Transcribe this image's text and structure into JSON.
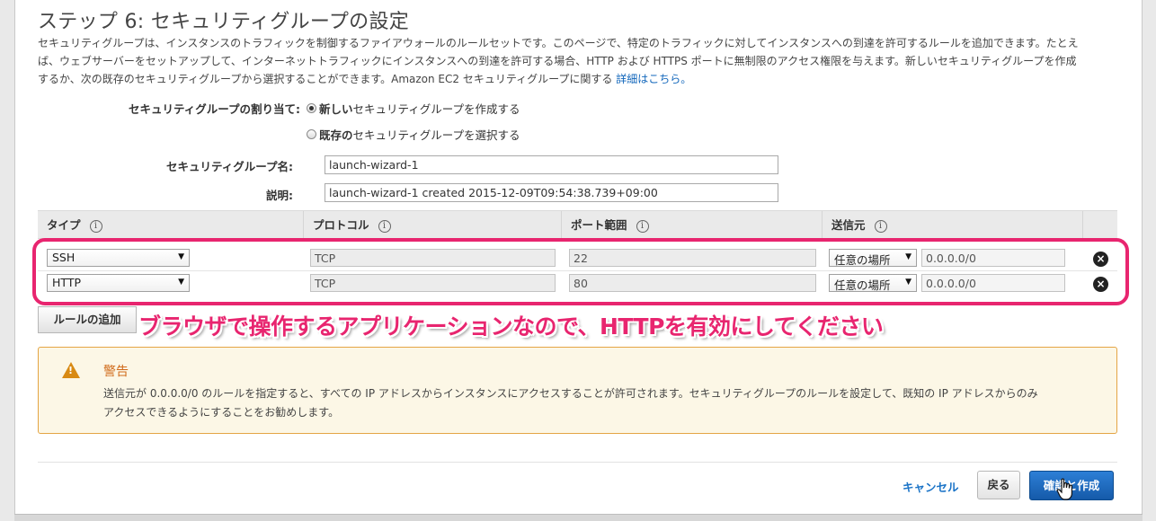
{
  "page": {
    "title": "ステップ 6: セキュリティグループの設定",
    "description_line1": "セキュリティグループは、インスタンスのトラフィックを制御するファイアウォールのルールセットです。このページで、特定のトラフィックに対してインスタンスへの到達を許可するルールを追加できます。たとえ",
    "description_line2": "ば、ウェブサーバーをセットアップして、インターネットトラフィックにインスタンスへの到達を許可する場合、HTTP および HTTPS ポートに無制限のアクセス権限を与えます。新しいセキュリティグループを作成",
    "description_line3": "するか、次の既存のセキュリティグループから選択することができます。Amazon EC2 セキュリティグループに関する",
    "description_link": "詳細はこちら。"
  },
  "assignment": {
    "label": "セキュリティグループの割り当て:",
    "option_new_bold": "新しい",
    "option_new_rest": "セキュリティグループを作成する",
    "option_existing_bold": "既存の",
    "option_existing_rest": "セキュリティグループを選択する"
  },
  "fields": {
    "name_label": "セキュリティグループ名:",
    "name_value": "launch-wizard-1",
    "desc_label": "説明:",
    "desc_value": "launch-wizard-1 created 2015-12-09T09:54:38.739+09:00"
  },
  "table": {
    "headers": [
      "タイプ",
      "プロトコル",
      "ポート範囲",
      "送信元"
    ],
    "info_glyph": "i",
    "rows": [
      {
        "type": "SSH",
        "protocol": "TCP",
        "port": "22",
        "source_type": "任意の場所",
        "source_cidr": "0.0.0.0/0"
      },
      {
        "type": "HTTP",
        "protocol": "TCP",
        "port": "80",
        "source_type": "任意の場所",
        "source_cidr": "0.0.0.0/0"
      }
    ],
    "remove_glyph": "×",
    "select_arrow": "▼"
  },
  "add_rule_label": "ルールの追加",
  "annotation": "ブラウザで操作するアプリケーションなので、HTTPを有効にしてください",
  "warning": {
    "icon": "warning-triangle-icon",
    "title": "警告",
    "body_line1": "送信元が 0.0.0.0/0 のルールを指定すると、すべての IP アドレスからインスタンスにアクセスすることが許可されます。セキュリティグループのルールを設定して、既知の IP アドレスからのみ",
    "body_line2": "アクセスできるようにすることをお勧めします。"
  },
  "footer": {
    "cancel_label": "キャンセル",
    "back_label": "戻る",
    "confirm_label": "確認と作成"
  },
  "colors": {
    "accent_pink": "#e8256f",
    "primary_blue": "#1a66c2",
    "warning_orange": "#d06b1a"
  }
}
